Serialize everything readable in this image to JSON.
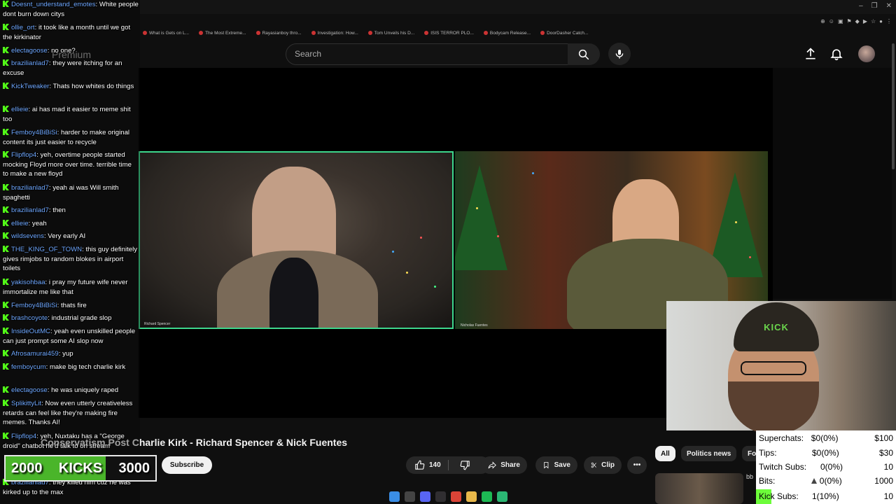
{
  "browser": {
    "bookmarks": [
      "What is Gets on L...",
      "The Most Extreme...",
      "Rayasianboy thro...",
      "Investigation: How...",
      "Tom Unveils his D...",
      "ISIS TERROR PLO...",
      "Bodycam Release...",
      "DoorDasher Catch..."
    ],
    "window_controls": [
      "–",
      "❐",
      "✕"
    ]
  },
  "youtube": {
    "logo_text": "Premium",
    "search_placeholder": "Search",
    "video_title": "Conservatism Post Charlie Kirk - Richard Spencer & Nick Fuentes",
    "subscribe_label": "Subscribe",
    "like_count": "140",
    "share_label": "Share",
    "save_label": "Save",
    "clip_label": "Clip",
    "more_label": "•••",
    "chips": [
      "All",
      "Politics news",
      "Fo"
    ],
    "rec_title": "bb",
    "left_label": "Richard Spencer",
    "right_label": "Nicholas Fuentes"
  },
  "webcam": {
    "cap_text": "KICK"
  },
  "stats": {
    "rows": [
      {
        "label": "Superchats:",
        "value": "$0(0%)",
        "goal": "$100"
      },
      {
        "label": "Tips:",
        "value": "$0(0%)",
        "goal": "$30"
      },
      {
        "label": "Twitch Subs:",
        "value": "0(0%)",
        "goal": "10"
      },
      {
        "label": "Bits:",
        "value": "0(0%)",
        "goal": "1000"
      },
      {
        "label": "Kick Subs:",
        "value": "1(10%)",
        "goal": "10"
      }
    ]
  },
  "goal_bar": {
    "current": "2000",
    "label": "KICKS",
    "target": "3000",
    "progress": 0.667
  },
  "chat": {
    "messages": [
      {
        "user": "Doesnt_understand_emotes",
        "text": "White people dont burn down citys"
      },
      {
        "user": "ollie_ort",
        "text": "it took like a month until we got the kirkinator"
      },
      {
        "user": "electagoose",
        "text": "no one?"
      },
      {
        "user": "brazilianlad7",
        "text": "they were itching for an excuse"
      },
      {
        "user": "KickTweaker",
        "text": "Thats how whites do things"
      },
      {
        "user": "ellieie",
        "text": "ai has mad it easier to meme shit too"
      },
      {
        "user": "Femboy4BiBiSi",
        "text": "harder to make original content its just easier to recycle"
      },
      {
        "user": "Flipflop4",
        "text": "yeh, overtime people started mocking Floyd more over time. terrible time to make a new floyd"
      },
      {
        "user": "brazilianlad7",
        "text": "yeah ai was Will smith spaghetti"
      },
      {
        "user": "brazilianlad7",
        "text": "then"
      },
      {
        "user": "ellieie",
        "text": "yeah"
      },
      {
        "user": "wildsevens",
        "text": "Very early AI"
      },
      {
        "user": "THE_KING_OF_TOWN",
        "text": "this guy definitely gives rimjobs to random blokes in airport toilets"
      },
      {
        "user": "yakisohbaa",
        "text": "i pray my future wife never immortalize me like that"
      },
      {
        "user": "Femboy4BiBiSi",
        "text": "thats fire"
      },
      {
        "user": "brashcoyote",
        "text": "industrial grade slop"
      },
      {
        "user": "InsideOutMC",
        "text": "yeah even unskilled people can just prompt some AI slop now"
      },
      {
        "user": "Afrosamurai459",
        "text": "yup"
      },
      {
        "user": "femboycum",
        "text": "make big tech charlie kirk"
      },
      {
        "user": "electagoose",
        "text": "he was uniquely raped"
      },
      {
        "user": "SplikittyLit",
        "text": "Now even utterly creativeless retards can feel like they're making fire memes. Thanks AI!"
      },
      {
        "user": "Flipflop4",
        "text": "yeh, Nuxtaku has a \"George droid\" chatbot he'd talk to on stream"
      },
      {
        "user": "brazilianlad7",
        "text": "they killed him cuz he was kirked up to the max"
      }
    ]
  }
}
